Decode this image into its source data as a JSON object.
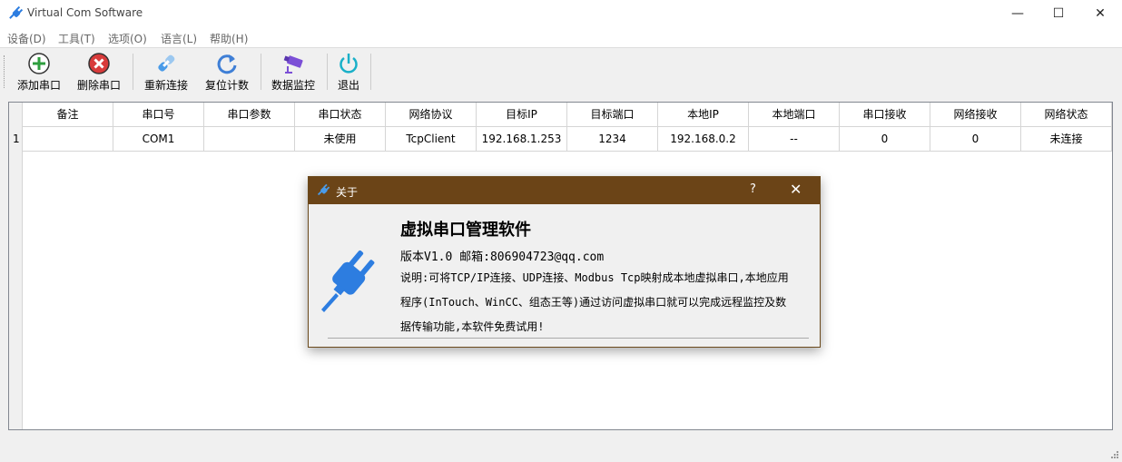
{
  "window": {
    "title": "Virtual Com Software",
    "minimize": "—",
    "maximize": "☐",
    "close": "✕"
  },
  "menu": [
    {
      "label": "设备(D)"
    },
    {
      "label": "工具(T)"
    },
    {
      "label": "选项(O)"
    },
    {
      "label": "语言(L)"
    },
    {
      "label": "帮助(H)"
    }
  ],
  "toolbar": {
    "add_label": "添加串口",
    "delete_label": "删除串口",
    "reconnect_label": "重新连接",
    "reset_label": "复位计数",
    "monitor_label": "数据监控",
    "exit_label": "退出"
  },
  "table": {
    "headers": [
      "备注",
      "串口号",
      "串口参数",
      "串口状态",
      "网络协议",
      "目标IP",
      "目标端口",
      "本地IP",
      "本地端口",
      "串口接收",
      "网络接收",
      "网络状态"
    ],
    "rows": [
      {
        "num": "1",
        "cells": [
          "",
          "COM1",
          "",
          "未使用",
          "TcpClient",
          "192.168.1.253",
          "1234",
          "192.168.0.2",
          "--",
          "0",
          "0",
          "未连接"
        ]
      }
    ]
  },
  "dialog": {
    "title": "关于",
    "help": "?",
    "close": "✕",
    "heading": "虚拟串口管理软件",
    "version_line": "版本V1.0 邮箱:806904723@qq.com",
    "desc_line1": "说明:可将TCP/IP连接、UDP连接、Modbus Tcp映射成本地虚拟串口,本地应用",
    "desc_line2": "程序(InTouch、WinCC、组态王等)通过访问虚拟串口就可以完成远程监控及数",
    "desc_line3": "据传输功能,本软件免费试用!"
  },
  "colors": {
    "accent_blue": "#2d7de0",
    "dialog_title_bg": "#6b4417",
    "add_green": "#2e9e3e",
    "delete_red": "#d83b3b",
    "exit_cyan": "#1ab0c8",
    "monitor_purple": "#7b4fd6"
  }
}
